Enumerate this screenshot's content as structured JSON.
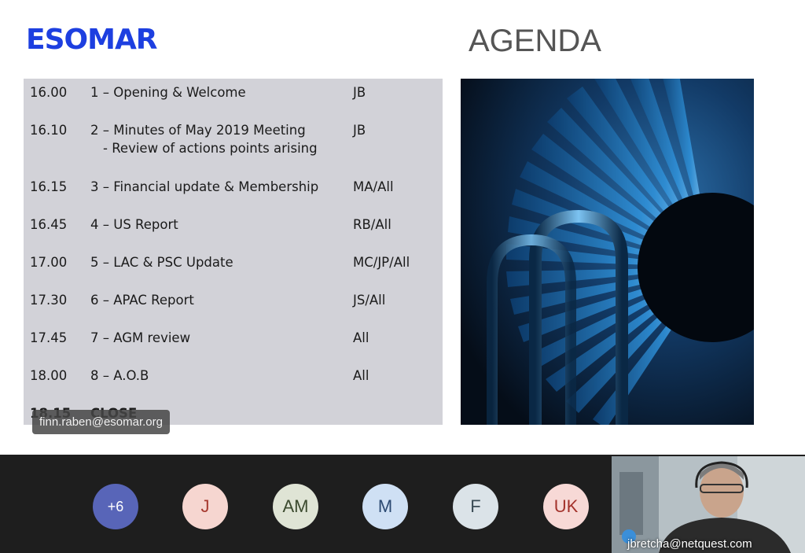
{
  "slide": {
    "logo": "ESOMAR",
    "title": "AGENDA",
    "agenda": [
      {
        "time": "16.00",
        "item": "1 – Opening & Welcome",
        "sub": "",
        "who": "JB"
      },
      {
        "time": "16.10",
        "item": "2 – Minutes of May 2019 Meeting",
        "sub": "- Review of actions points arising",
        "who": "JB"
      },
      {
        "time": "16.15",
        "item": "3 – Financial update & Membership",
        "sub": "",
        "who": "MA/All"
      },
      {
        "time": "16.45",
        "item": "4 – US Report",
        "sub": "",
        "who": "RB/All"
      },
      {
        "time": "17.00",
        "item": "5 – LAC & PSC Update",
        "sub": "",
        "who": "MC/JP/All"
      },
      {
        "time": "17.30",
        "item": "6 – APAC Report",
        "sub": "",
        "who": "JS/All"
      },
      {
        "time": "17.45",
        "item": "7 – AGM review",
        "sub": "",
        "who": "All"
      },
      {
        "time": "18.00",
        "item": "8 – A.O.B",
        "sub": "",
        "who": "All"
      },
      {
        "time": "18.15",
        "item": "CLOSE",
        "sub": "",
        "who": ""
      }
    ],
    "presenter": "finn.raben@esomar.org"
  },
  "participants": {
    "more_count": "+6",
    "avatars": [
      {
        "initials": "J",
        "bg": "#f6d6d0",
        "fg": "#a63a2f"
      },
      {
        "initials": "AM",
        "bg": "#dfe4d5",
        "fg": "#3b4a2e"
      },
      {
        "initials": "M",
        "bg": "#cfe0f4",
        "fg": "#2c4a72"
      },
      {
        "initials": "F",
        "bg": "#dbe3e8",
        "fg": "#3b4c56"
      },
      {
        "initials": "UK",
        "bg": "#f7d9d6",
        "fg": "#a3322b"
      }
    ],
    "more_bg": "#5865b8"
  },
  "self_view": {
    "name": "jbretcha@netquest.com"
  },
  "colors": {
    "brand": "#1d3fe0",
    "agenda_bg": "#d2d2d8",
    "strip_bg": "#1e1e1e"
  }
}
